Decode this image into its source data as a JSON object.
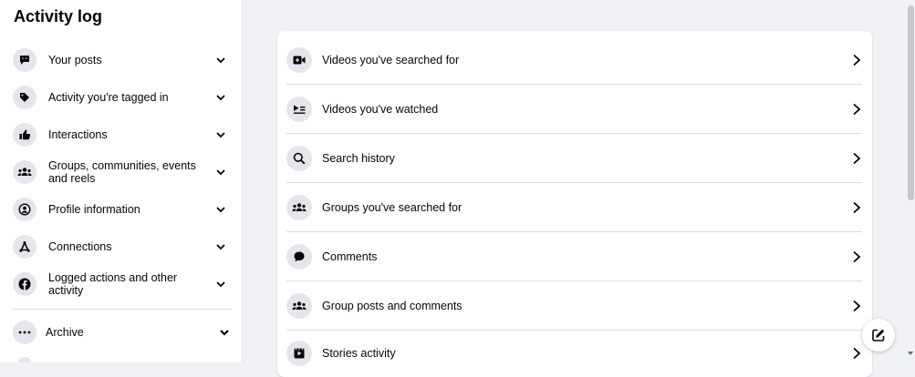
{
  "sidebar": {
    "title": "Activity log",
    "items": [
      {
        "label": "Your posts",
        "icon": "speech-bubble-icon"
      },
      {
        "label": "Activity you're tagged in",
        "icon": "tag-icon"
      },
      {
        "label": "Interactions",
        "icon": "thumbs-up-icon"
      },
      {
        "label": "Groups, communities, events and reels",
        "icon": "group-icon"
      },
      {
        "label": "Profile information",
        "icon": "profile-icon"
      },
      {
        "label": "Connections",
        "icon": "connections-icon"
      },
      {
        "label": "Logged actions and other activity",
        "icon": "facebook-icon"
      },
      {
        "label": "Archive",
        "icon": "more-icon"
      }
    ]
  },
  "main": {
    "rows": [
      {
        "label": "Videos you've searched for",
        "icon": "video-camera-icon"
      },
      {
        "label": "Videos you've watched",
        "icon": "video-list-icon"
      },
      {
        "label": "Search history",
        "icon": "search-icon"
      },
      {
        "label": "Groups you've searched for",
        "icon": "group-icon"
      },
      {
        "label": "Comments",
        "icon": "comment-icon"
      },
      {
        "label": "Group posts and comments",
        "icon": "group-icon"
      },
      {
        "label": "Stories activity",
        "icon": "stories-icon"
      }
    ]
  },
  "colors": {
    "page_background": "#f0f2f5",
    "card_background": "#ffffff",
    "icon_circle": "#e4e6eb",
    "text": "#050505",
    "divider": "#dadde1"
  }
}
